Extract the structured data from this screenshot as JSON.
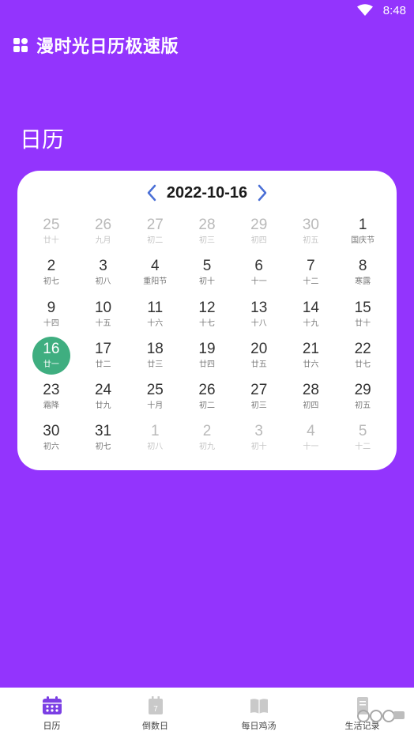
{
  "status_bar": {
    "time": "8:48"
  },
  "header": {
    "app_title": "漫时光日历极速版"
  },
  "section_title": "日历",
  "calendar": {
    "current_date": "2022-10-16",
    "days": [
      {
        "num": "25",
        "lunar": "廿十",
        "other": true
      },
      {
        "num": "26",
        "lunar": "九月",
        "other": true
      },
      {
        "num": "27",
        "lunar": "初二",
        "other": true
      },
      {
        "num": "28",
        "lunar": "初三",
        "other": true
      },
      {
        "num": "29",
        "lunar": "初四",
        "other": true
      },
      {
        "num": "30",
        "lunar": "初五",
        "other": true
      },
      {
        "num": "1",
        "lunar": "国庆节"
      },
      {
        "num": "2",
        "lunar": "初七"
      },
      {
        "num": "3",
        "lunar": "初八"
      },
      {
        "num": "4",
        "lunar": "重阳节"
      },
      {
        "num": "5",
        "lunar": "初十"
      },
      {
        "num": "6",
        "lunar": "十一"
      },
      {
        "num": "7",
        "lunar": "十二"
      },
      {
        "num": "8",
        "lunar": "寒露"
      },
      {
        "num": "9",
        "lunar": "十四"
      },
      {
        "num": "10",
        "lunar": "十五"
      },
      {
        "num": "11",
        "lunar": "十六"
      },
      {
        "num": "12",
        "lunar": "十七"
      },
      {
        "num": "13",
        "lunar": "十八"
      },
      {
        "num": "14",
        "lunar": "十九"
      },
      {
        "num": "15",
        "lunar": "廿十"
      },
      {
        "num": "16",
        "lunar": "廿一",
        "selected": true
      },
      {
        "num": "17",
        "lunar": "廿二"
      },
      {
        "num": "18",
        "lunar": "廿三"
      },
      {
        "num": "19",
        "lunar": "廿四"
      },
      {
        "num": "20",
        "lunar": "廿五"
      },
      {
        "num": "21",
        "lunar": "廿六"
      },
      {
        "num": "22",
        "lunar": "廿七"
      },
      {
        "num": "23",
        "lunar": "霜降"
      },
      {
        "num": "24",
        "lunar": "廿九"
      },
      {
        "num": "25",
        "lunar": "十月"
      },
      {
        "num": "26",
        "lunar": "初二"
      },
      {
        "num": "27",
        "lunar": "初三"
      },
      {
        "num": "28",
        "lunar": "初四"
      },
      {
        "num": "29",
        "lunar": "初五"
      },
      {
        "num": "30",
        "lunar": "初六"
      },
      {
        "num": "31",
        "lunar": "初七"
      },
      {
        "num": "1",
        "lunar": "初八",
        "other": true
      },
      {
        "num": "2",
        "lunar": "初九",
        "other": true
      },
      {
        "num": "3",
        "lunar": "初十",
        "other": true
      },
      {
        "num": "4",
        "lunar": "十一",
        "other": true
      },
      {
        "num": "5",
        "lunar": "十二",
        "other": true
      }
    ]
  },
  "bottom_nav": {
    "items": [
      {
        "label": "日历",
        "icon": "calendar-icon",
        "active": true
      },
      {
        "label": "倒数日",
        "icon": "countdown-icon"
      },
      {
        "label": "每日鸡汤",
        "icon": "book-icon"
      },
      {
        "label": "生活记录",
        "icon": "note-icon"
      }
    ]
  },
  "colors": {
    "background": "#9334fd",
    "accent": "#7b3fe4",
    "selected": "#3fae80",
    "nav_arrow": "#4a6fd6"
  }
}
